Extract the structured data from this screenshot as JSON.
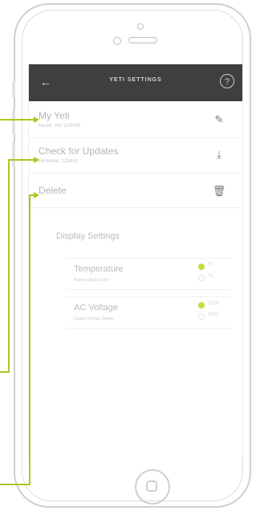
{
  "header": {
    "title": "YETI SETTINGS",
    "back_icon": "back-arrow-icon",
    "help_icon": "help-icon",
    "help_glyph": "?"
  },
  "rows": [
    {
      "title": "My Yeti",
      "subtitle": "Model: Yeti 1000HE",
      "icon": "pencil-edit-icon"
    },
    {
      "title": "Check for Updates",
      "subtitle": "Firmware: 1234AS",
      "icon": "download-icon"
    },
    {
      "title": "Delete",
      "subtitle": "",
      "icon": "trash-icon"
    }
  ],
  "display_settings": {
    "title": "Display Settings",
    "temperature": {
      "title": "Temperature",
      "subtitle": "Battery Display Unit",
      "options": [
        {
          "label": "°F",
          "selected": true
        },
        {
          "label": "°C",
          "selected": false
        }
      ]
    },
    "ac_voltage": {
      "title": "AC Voltage",
      "subtitle": "Output Voltage Setting",
      "options": [
        {
          "label": "120V",
          "selected": true
        },
        {
          "label": "230V",
          "selected": false
        }
      ]
    }
  },
  "colors": {
    "accent": "#afc525",
    "topbar": "#3f3f3f"
  }
}
